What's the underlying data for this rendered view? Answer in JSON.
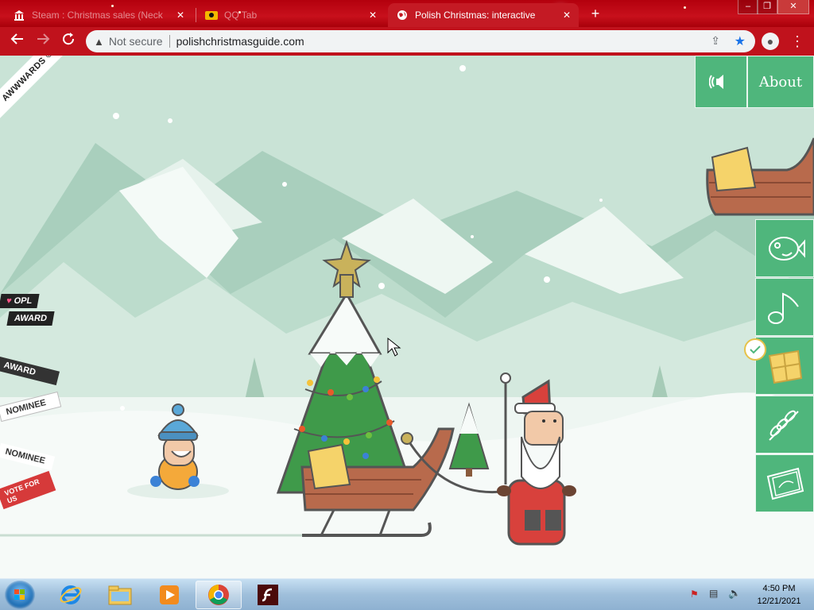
{
  "browser": {
    "tabs": [
      {
        "title": "Steam : Christmas sales (Neck",
        "active": false
      },
      {
        "title": "QQ Tab",
        "active": false
      },
      {
        "title": "Polish Christmas: interactive",
        "active": true
      }
    ],
    "new_tab_label": "+",
    "window_controls": [
      "–",
      "❐",
      "✕"
    ],
    "address": {
      "security_text": "Not secure",
      "url": "polishchristmasguide.com"
    }
  },
  "page": {
    "sound_icon": "speaker-icon",
    "about_label": "About",
    "awwwards_badge": "AWWWARDS ©H.M",
    "ribbons": {
      "opl": "OPL",
      "opl_award": "AWARD",
      "css_award": "AWARD",
      "css_nominee": "NOMINEE",
      "nominee": "NOMINEE",
      "vote": "VOTE FOR US"
    },
    "side_menu": [
      {
        "icon": "fish-icon",
        "name": "fish"
      },
      {
        "icon": "music-note-icon",
        "name": "carols"
      },
      {
        "icon": "gift-icon",
        "name": "gifts",
        "checked": true
      },
      {
        "icon": "wheat-icon",
        "name": "wheat"
      },
      {
        "icon": "wafer-icon",
        "name": "wafer"
      }
    ],
    "colors": {
      "menu_green": "#4fb67c",
      "sky": "#c9e3d6",
      "sled": "#b86a4c",
      "tree": "#3f9a4a"
    }
  },
  "taskbar": {
    "apps": [
      "start-orb",
      "internet-explorer-icon",
      "file-explorer-icon",
      "media-player-icon",
      "chrome-icon",
      "flash-icon"
    ],
    "clock_time": "4:50 PM",
    "clock_date": "12/21/2021"
  }
}
